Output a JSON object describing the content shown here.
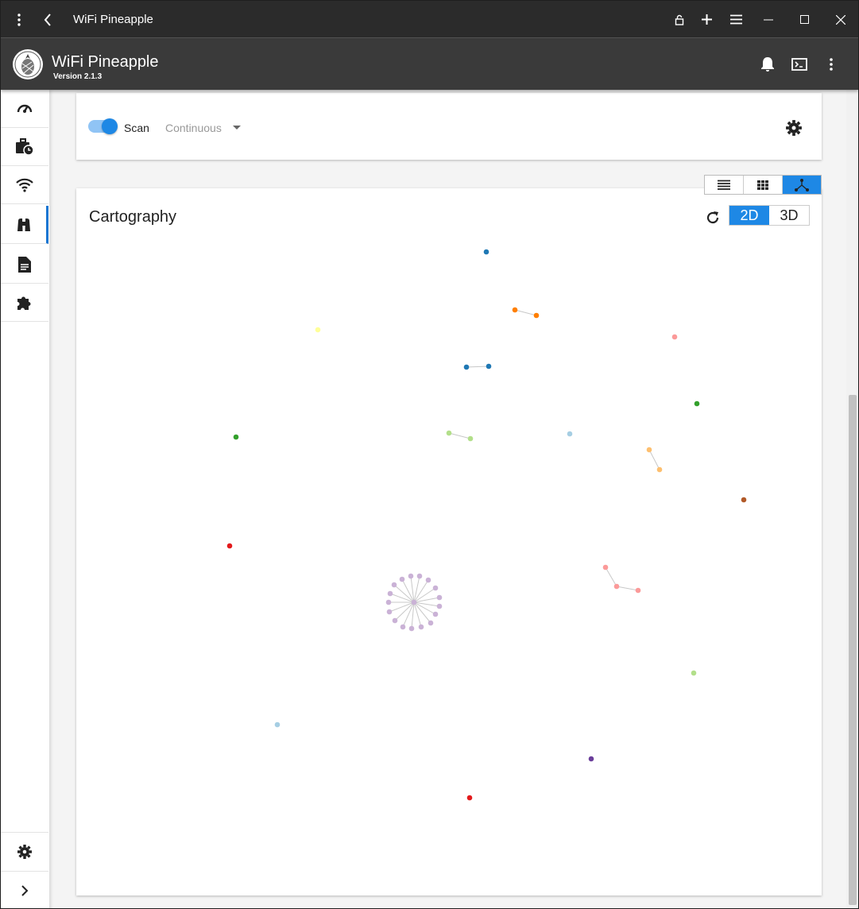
{
  "window": {
    "title": "WiFi Pineapple"
  },
  "header": {
    "title": "WiFi Pineapple",
    "version": "Version 2.1.3"
  },
  "sidebar": {
    "items": [
      {
        "icon": "speedometer-icon",
        "name": "dashboard"
      },
      {
        "icon": "briefcase-clock-icon",
        "name": "campaigns"
      },
      {
        "icon": "wifi-icon",
        "name": "pineap"
      },
      {
        "icon": "binoculars-icon",
        "name": "recon",
        "active": true
      },
      {
        "icon": "document-icon",
        "name": "logs"
      },
      {
        "icon": "puzzle-icon",
        "name": "modules"
      }
    ],
    "bottom": [
      {
        "icon": "gear-icon",
        "name": "settings"
      },
      {
        "icon": "chevron-right-icon",
        "name": "expand"
      }
    ]
  },
  "scan": {
    "label": "Scan",
    "enabled": true,
    "mode": "Continuous"
  },
  "view_modes": [
    "list-icon",
    "grid-icon",
    "graph-icon"
  ],
  "active_view": "graph-icon",
  "cartography": {
    "title": "Cartography",
    "dimensions": [
      "2D",
      "3D"
    ],
    "active_dimension": "2D"
  },
  "graph_colors": {
    "blue": "#1f78b4",
    "orange": "#ff7f00",
    "yellow": "#ffff99",
    "pink": "#fb9a99",
    "green": "#33a02c",
    "lightgreen": "#b2df8a",
    "lightblue": "#a6cee3",
    "peach": "#fdbf6f",
    "brown": "#b15928",
    "red": "#e31a1c",
    "lavender": "#cab2d6",
    "purple": "#6a3d9a"
  }
}
